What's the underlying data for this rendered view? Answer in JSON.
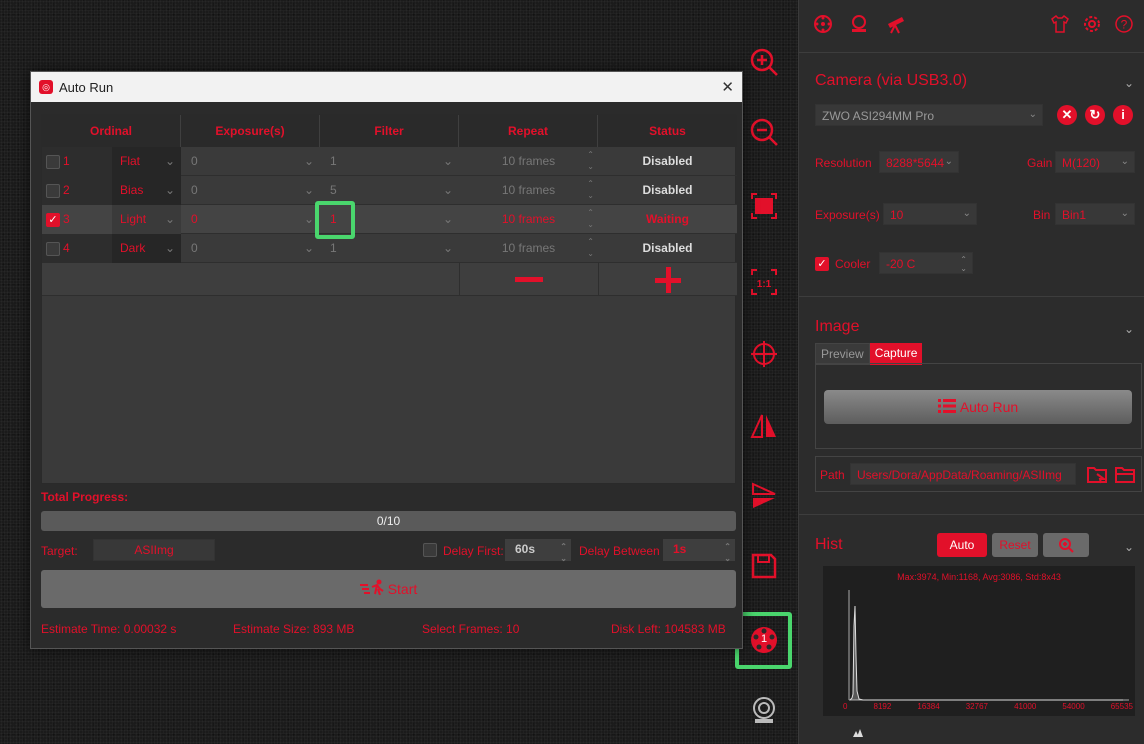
{
  "toolbar_right": {
    "top_icons": [
      "gear-icon",
      "camera-icon",
      "telescope-icon"
    ],
    "top_right_icons": [
      "shirt-icon",
      "settings-icon",
      "help-icon"
    ]
  },
  "camera": {
    "title": "Camera (via USB3.0)",
    "model": "ZWO ASI294MM Pro",
    "resolution_label": "Resolution",
    "resolution_value": "8288*5644",
    "gain_label": "Gain",
    "gain_value": "M(120)",
    "exposure_label": "Exposure(s)",
    "exposure_value": "10",
    "bin_label": "Bin",
    "bin_value": "Bin1",
    "cooler_label": "Cooler",
    "cooler_value": "-20 C"
  },
  "image": {
    "title": "Image",
    "tabs": [
      "Preview",
      "Capture"
    ],
    "active_tab": "Capture",
    "auto_run_label": "Auto Run",
    "path_label": "Path",
    "path_value": "Users/Dora/AppData/Roaming/ASIImg"
  },
  "hist": {
    "title": "Hist",
    "auto_label": "Auto",
    "reset_label": "Reset",
    "stats": "Max:3974, Min:1168, Avg:3086, Std:8x43",
    "ticks": [
      "0",
      "8192",
      "16384",
      "32767",
      "41000",
      "54000",
      "65535"
    ]
  },
  "dialog": {
    "title": "Auto Run",
    "columns": [
      "Ordinal",
      "Exposure(s)",
      "Filter",
      "Repeat",
      "Status"
    ],
    "rows": [
      {
        "n": "1",
        "checked": false,
        "type": "Flat",
        "exposure": "0",
        "filter": "1",
        "repeat": "10 frames",
        "status": "Disabled"
      },
      {
        "n": "2",
        "checked": false,
        "type": "Bias",
        "exposure": "0",
        "filter": "5",
        "repeat": "10 frames",
        "status": "Disabled"
      },
      {
        "n": "3",
        "checked": true,
        "type": "Light",
        "exposure": "0",
        "filter": "1",
        "repeat": "10 frames",
        "status": "Waiting"
      },
      {
        "n": "4",
        "checked": false,
        "type": "Dark",
        "exposure": "0",
        "filter": "1",
        "repeat": "10 frames",
        "status": "Disabled"
      }
    ],
    "total_progress_label": "Total Progress:",
    "progress_text": "0/10",
    "progress_value": 0,
    "target_label": "Target:",
    "target_value": "ASIImg",
    "delay_first_label": "Delay First:",
    "delay_first_value": "60s",
    "delay_between_label": "Delay Between",
    "delay_between_value": "1s",
    "start_label": "Start",
    "estimate_time_label": "Estimate Time:",
    "estimate_time_value": "0.00032 s",
    "estimate_size_label": "Estimate Size:",
    "estimate_size_value": "893 MB",
    "select_frames_label": "Select Frames:",
    "select_frames_value": "10",
    "disk_left_label": "Disk Left:",
    "disk_left_value": "104583 MB"
  },
  "filter_wheel_badge": "1",
  "colors": {
    "accent": "#e2102a",
    "highlight": "#4ad66d",
    "panel": "#2c2c2c"
  }
}
